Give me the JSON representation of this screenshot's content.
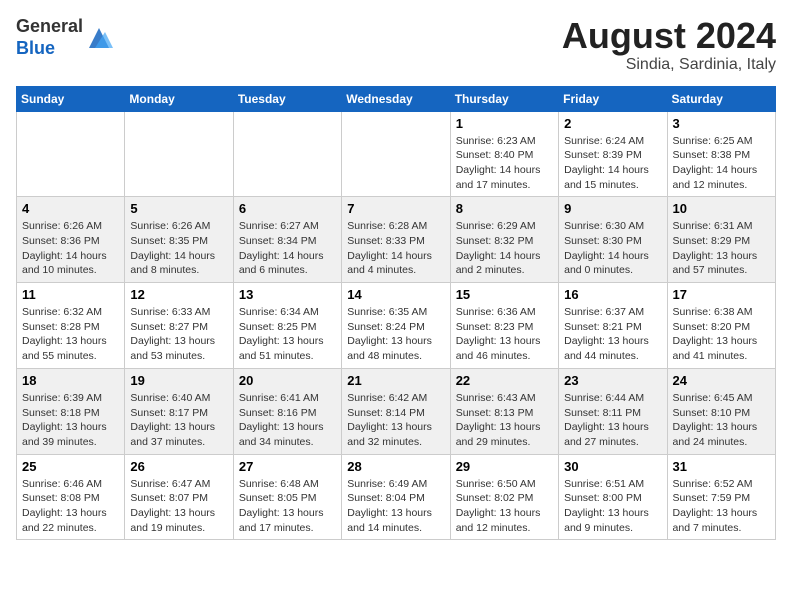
{
  "header": {
    "logo": {
      "line1": "General",
      "line2": "Blue"
    },
    "title": "August 2024",
    "location": "Sindia, Sardinia, Italy"
  },
  "calendar": {
    "days_of_week": [
      "Sunday",
      "Monday",
      "Tuesday",
      "Wednesday",
      "Thursday",
      "Friday",
      "Saturday"
    ],
    "weeks": [
      [
        {
          "day": null,
          "info": null
        },
        {
          "day": null,
          "info": null
        },
        {
          "day": null,
          "info": null
        },
        {
          "day": null,
          "info": null
        },
        {
          "day": "1",
          "info": "Sunrise: 6:23 AM\nSunset: 8:40 PM\nDaylight: 14 hours and 17 minutes."
        },
        {
          "day": "2",
          "info": "Sunrise: 6:24 AM\nSunset: 8:39 PM\nDaylight: 14 hours and 15 minutes."
        },
        {
          "day": "3",
          "info": "Sunrise: 6:25 AM\nSunset: 8:38 PM\nDaylight: 14 hours and 12 minutes."
        }
      ],
      [
        {
          "day": "4",
          "info": "Sunrise: 6:26 AM\nSunset: 8:36 PM\nDaylight: 14 hours and 10 minutes."
        },
        {
          "day": "5",
          "info": "Sunrise: 6:26 AM\nSunset: 8:35 PM\nDaylight: 14 hours and 8 minutes."
        },
        {
          "day": "6",
          "info": "Sunrise: 6:27 AM\nSunset: 8:34 PM\nDaylight: 14 hours and 6 minutes."
        },
        {
          "day": "7",
          "info": "Sunrise: 6:28 AM\nSunset: 8:33 PM\nDaylight: 14 hours and 4 minutes."
        },
        {
          "day": "8",
          "info": "Sunrise: 6:29 AM\nSunset: 8:32 PM\nDaylight: 14 hours and 2 minutes."
        },
        {
          "day": "9",
          "info": "Sunrise: 6:30 AM\nSunset: 8:30 PM\nDaylight: 14 hours and 0 minutes."
        },
        {
          "day": "10",
          "info": "Sunrise: 6:31 AM\nSunset: 8:29 PM\nDaylight: 13 hours and 57 minutes."
        }
      ],
      [
        {
          "day": "11",
          "info": "Sunrise: 6:32 AM\nSunset: 8:28 PM\nDaylight: 13 hours and 55 minutes."
        },
        {
          "day": "12",
          "info": "Sunrise: 6:33 AM\nSunset: 8:27 PM\nDaylight: 13 hours and 53 minutes."
        },
        {
          "day": "13",
          "info": "Sunrise: 6:34 AM\nSunset: 8:25 PM\nDaylight: 13 hours and 51 minutes."
        },
        {
          "day": "14",
          "info": "Sunrise: 6:35 AM\nSunset: 8:24 PM\nDaylight: 13 hours and 48 minutes."
        },
        {
          "day": "15",
          "info": "Sunrise: 6:36 AM\nSunset: 8:23 PM\nDaylight: 13 hours and 46 minutes."
        },
        {
          "day": "16",
          "info": "Sunrise: 6:37 AM\nSunset: 8:21 PM\nDaylight: 13 hours and 44 minutes."
        },
        {
          "day": "17",
          "info": "Sunrise: 6:38 AM\nSunset: 8:20 PM\nDaylight: 13 hours and 41 minutes."
        }
      ],
      [
        {
          "day": "18",
          "info": "Sunrise: 6:39 AM\nSunset: 8:18 PM\nDaylight: 13 hours and 39 minutes."
        },
        {
          "day": "19",
          "info": "Sunrise: 6:40 AM\nSunset: 8:17 PM\nDaylight: 13 hours and 37 minutes."
        },
        {
          "day": "20",
          "info": "Sunrise: 6:41 AM\nSunset: 8:16 PM\nDaylight: 13 hours and 34 minutes."
        },
        {
          "day": "21",
          "info": "Sunrise: 6:42 AM\nSunset: 8:14 PM\nDaylight: 13 hours and 32 minutes."
        },
        {
          "day": "22",
          "info": "Sunrise: 6:43 AM\nSunset: 8:13 PM\nDaylight: 13 hours and 29 minutes."
        },
        {
          "day": "23",
          "info": "Sunrise: 6:44 AM\nSunset: 8:11 PM\nDaylight: 13 hours and 27 minutes."
        },
        {
          "day": "24",
          "info": "Sunrise: 6:45 AM\nSunset: 8:10 PM\nDaylight: 13 hours and 24 minutes."
        }
      ],
      [
        {
          "day": "25",
          "info": "Sunrise: 6:46 AM\nSunset: 8:08 PM\nDaylight: 13 hours and 22 minutes."
        },
        {
          "day": "26",
          "info": "Sunrise: 6:47 AM\nSunset: 8:07 PM\nDaylight: 13 hours and 19 minutes."
        },
        {
          "day": "27",
          "info": "Sunrise: 6:48 AM\nSunset: 8:05 PM\nDaylight: 13 hours and 17 minutes."
        },
        {
          "day": "28",
          "info": "Sunrise: 6:49 AM\nSunset: 8:04 PM\nDaylight: 13 hours and 14 minutes."
        },
        {
          "day": "29",
          "info": "Sunrise: 6:50 AM\nSunset: 8:02 PM\nDaylight: 13 hours and 12 minutes."
        },
        {
          "day": "30",
          "info": "Sunrise: 6:51 AM\nSunset: 8:00 PM\nDaylight: 13 hours and 9 minutes."
        },
        {
          "day": "31",
          "info": "Sunrise: 6:52 AM\nSunset: 7:59 PM\nDaylight: 13 hours and 7 minutes."
        }
      ]
    ]
  }
}
